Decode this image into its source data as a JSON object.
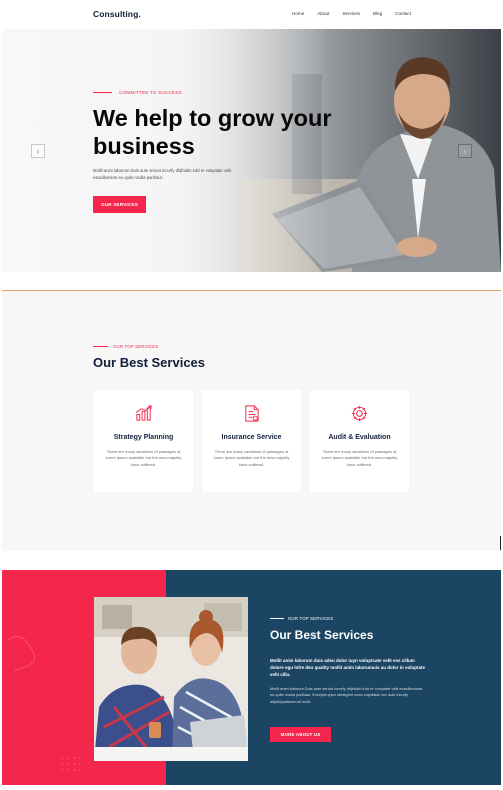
{
  "brand": {
    "logo": "Consulting.",
    "accent": "#f5264c",
    "navy": "#1c4563"
  },
  "nav": {
    "items": [
      "Home",
      "About",
      "Services",
      "Blog",
      "Contact"
    ]
  },
  "hero": {
    "eyebrow": "COMMITTED TO SUCCESS",
    "title": "We help to grow your business",
    "description": "Mollit anim laborum.Duis aute serunt incurfy dhjfoidm irdd re voluptate velit esacillumlore eu quile nnulla parihaur.",
    "button": "OUR SERVICES",
    "prev_icon": "chevron-left-icon",
    "next_icon": "chevron-right-icon"
  },
  "services": {
    "eyebrow": "OUR TOP SERVICES",
    "title": "Our Best Services",
    "cards": [
      {
        "icon": "strategy-chart-icon",
        "title": "Strategy Planning",
        "desc": "There are many variations of passages of lorem Ipsum available but the new majority have suffered."
      },
      {
        "icon": "insurance-document-icon",
        "title": "Insurance Service",
        "desc": "There are many variations of passages of lorem Ipsum available but the new majority have suffered."
      },
      {
        "icon": "audit-gear-icon",
        "title": "Audit & Evaluation",
        "desc": "There are many variations of passages of lorem Ipsum available but the new majority have suffered."
      }
    ]
  },
  "about": {
    "eyebrow": "OUR TOP SERVICES",
    "title": "Our Best Services",
    "lead": "Mollit anim laborum duis adeu dolor iuyn voluptcate velit ess cillum dolore egu lofre deu quality mollit anim laborumuis au dolor in voluptate velit cillu.",
    "description": "Mollit anim laborum.Duis aute serunt incurfy dhjfoidm irdd re voluptate velit esacillumlore eu quile nnulla parihaur. Excepteuysor sfeatgrint ocea cupidatat non auie incurfy dhjfoidpadeserunt molit.",
    "button": "MORE ABOUT US"
  }
}
